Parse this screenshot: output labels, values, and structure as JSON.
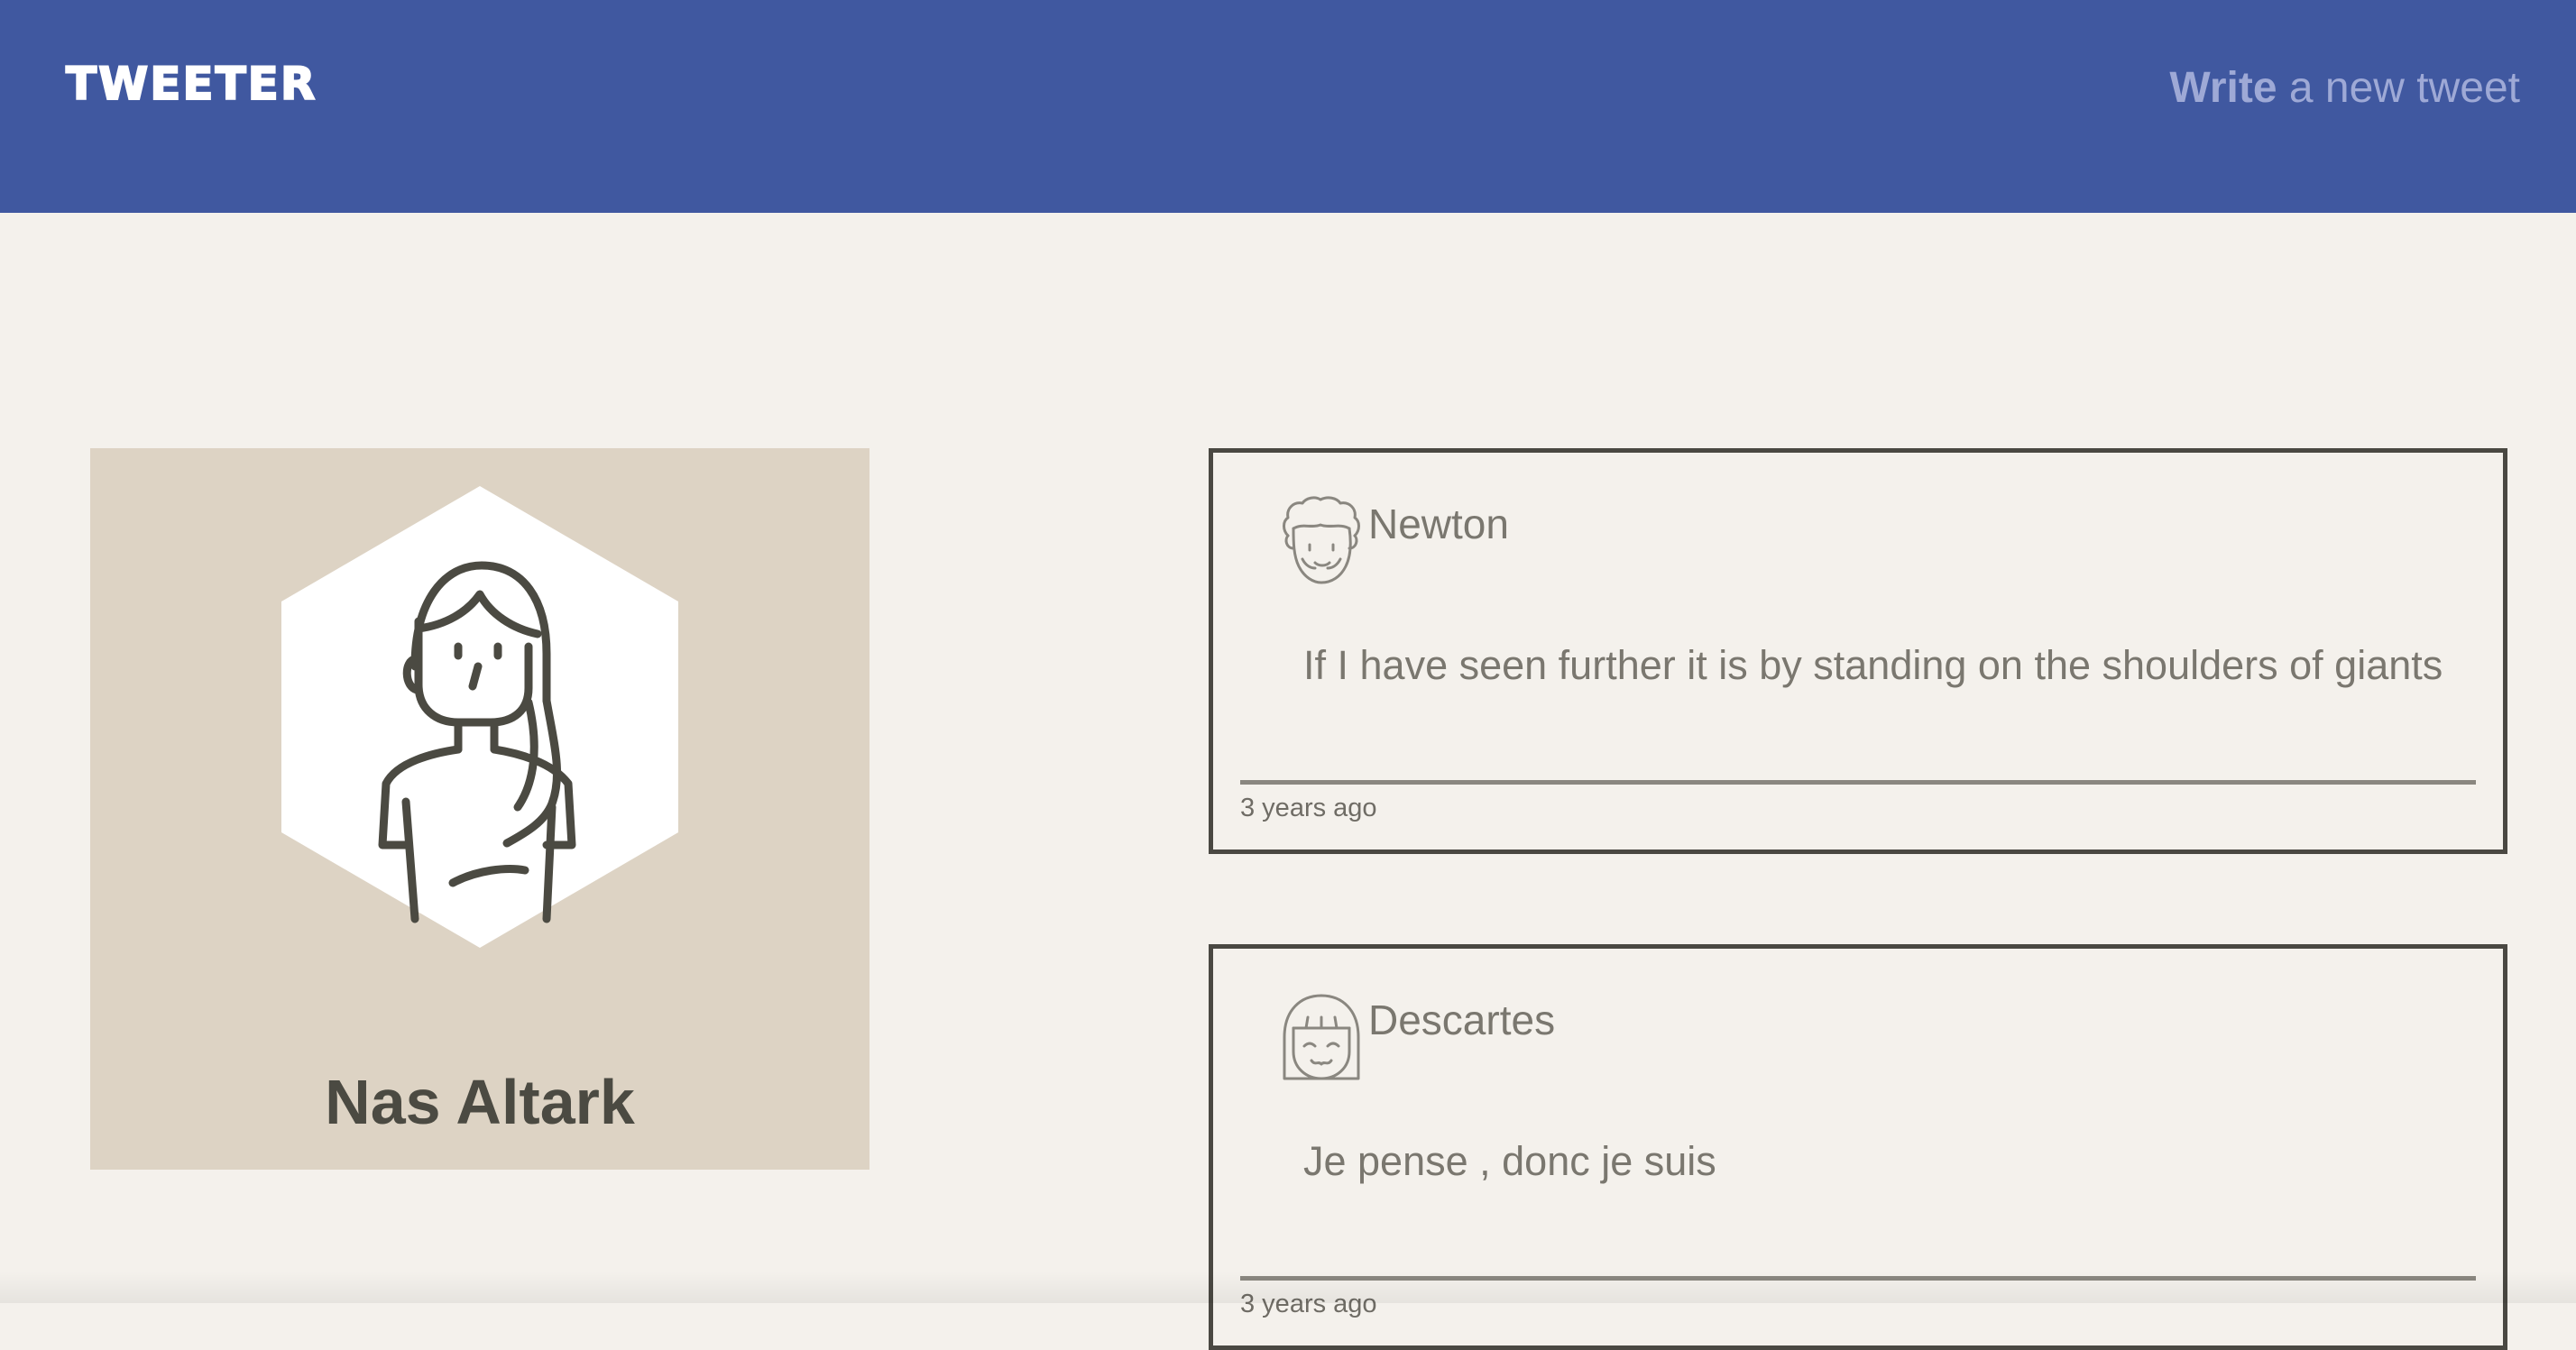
{
  "nav": {
    "brand": "TWEETER",
    "compose_strong": "Write",
    "compose_rest": " a new tweet"
  },
  "profile": {
    "name": "Nas Altark",
    "avatar_icon": "female-user-avatar-icon"
  },
  "tweets": [
    {
      "author": "Newton",
      "avatar_icon": "curly-hair-avatar-icon",
      "text": "If I have seen further it is by standing on the shoulders of giants",
      "time": "3 years ago"
    },
    {
      "author": "Descartes",
      "avatar_icon": "bob-hair-avatar-icon",
      "text": "Je pense , donc je suis",
      "time": "3 years ago"
    }
  ],
  "colors": {
    "navbar": "#4058a0",
    "page_background": "#f4f1ec",
    "profile_card": "#ddd3c4",
    "tweet_border": "#4a4842",
    "compose_text": "#9ea9d6"
  }
}
